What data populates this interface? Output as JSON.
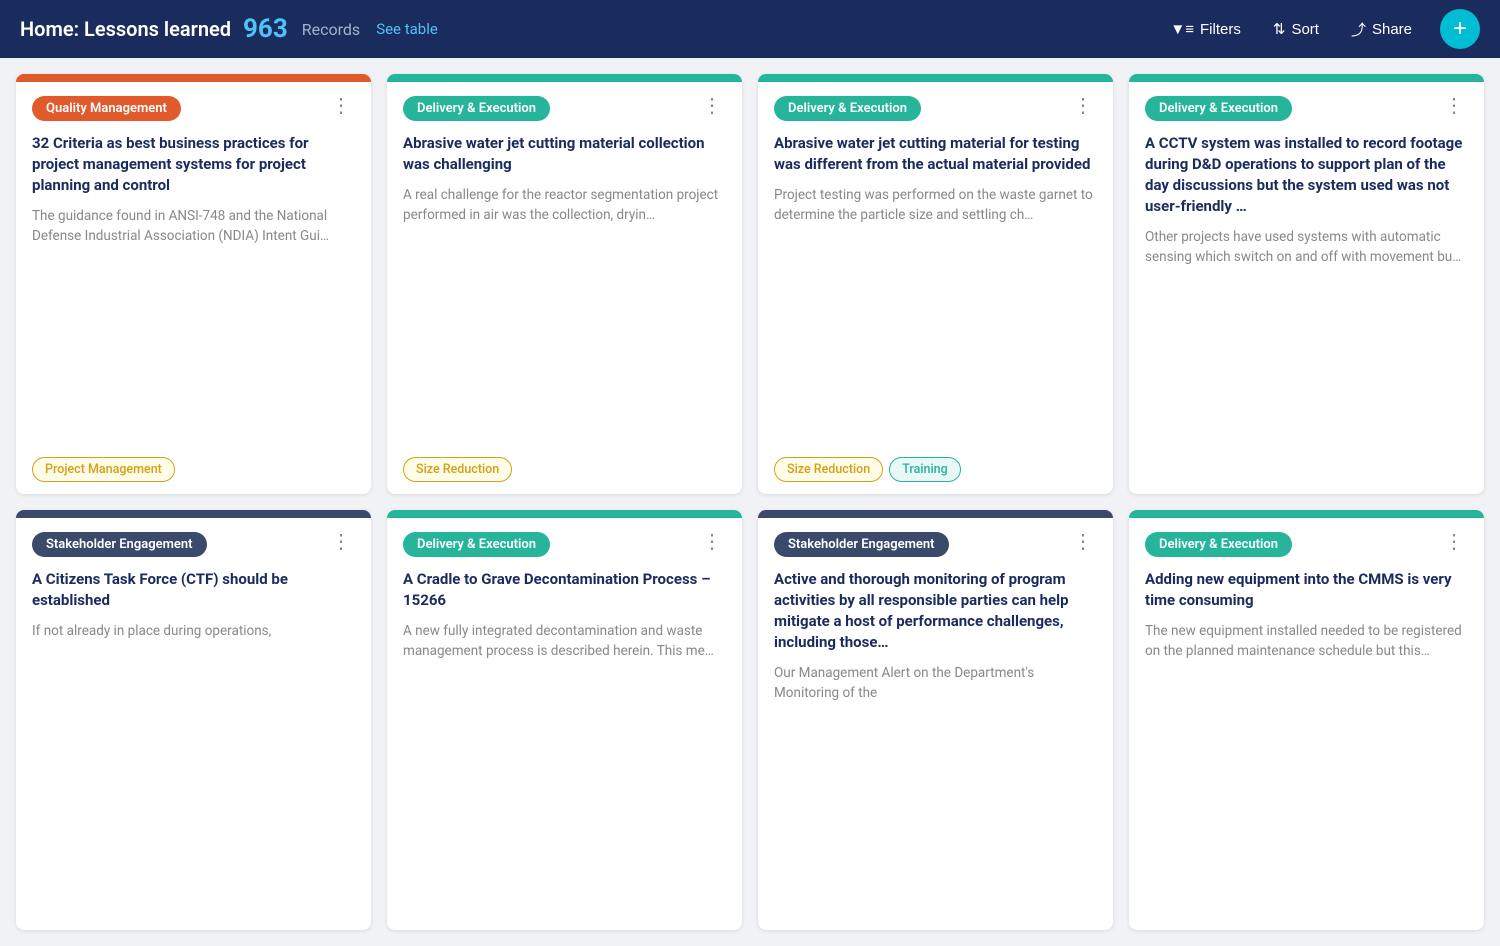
{
  "header": {
    "title": "Home: Lessons learned",
    "count": "963",
    "records_label": "Records",
    "see_table": "See table",
    "filters_label": "Filters",
    "sort_label": "Sort",
    "share_label": "Share",
    "add_label": "+"
  },
  "cards": [
    {
      "id": "card-1",
      "top_color": "#e05a2b",
      "badge_label": "Quality Management",
      "badge_class": "badge-red",
      "accent_class": "accent-blue",
      "title": "32 Criteria as best business practices for project management systems for project planning and control",
      "desc": "The guidance found in ANSI-748 and the National Defense Industrial Association (NDIA) Intent Gui…",
      "tags": [
        {
          "label": "Project Management",
          "class": "tag-yellow"
        }
      ]
    },
    {
      "id": "card-2",
      "top_color": "#26b59b",
      "badge_label": "Delivery & Execution",
      "badge_class": "badge-teal",
      "accent_class": "accent-teal",
      "title": "Abrasive water jet cutting material collection was challenging",
      "desc": "A real challenge for the reactor segmentation project performed in air was the collection, dryin…",
      "tags": [
        {
          "label": "Size Reduction",
          "class": "tag-yellow"
        }
      ]
    },
    {
      "id": "card-3",
      "top_color": "#26b59b",
      "badge_label": "Delivery & Execution",
      "badge_class": "badge-teal",
      "accent_class": "accent-teal",
      "title": "Abrasive water jet cutting material for testing was different from the actual material provided",
      "desc": "Project testing was performed on the waste garnet to determine the particle size and settling ch…",
      "tags": [
        {
          "label": "Size Reduction",
          "class": "tag-yellow"
        },
        {
          "label": "Training",
          "class": "tag-green"
        }
      ]
    },
    {
      "id": "card-4",
      "top_color": "#26b59b",
      "badge_label": "Delivery & Execution",
      "badge_class": "badge-teal",
      "accent_class": "accent-teal",
      "title": "A CCTV system was installed to record footage during D&D operations to support plan of the day discussions but the system used was not user-friendly …",
      "desc": "Other projects have used systems with automatic sensing which switch on and off with movement bu…",
      "tags": []
    },
    {
      "id": "card-5",
      "top_color": "#3a4a6b",
      "badge_label": "Stakeholder Engagement",
      "badge_class": "badge-dark",
      "accent_class": "accent-dark",
      "title": "A Citizens Task Force (CTF) should be established",
      "desc": "If not already in place during operations,",
      "tags": []
    },
    {
      "id": "card-6",
      "top_color": "#26b59b",
      "badge_label": "Delivery & Execution",
      "badge_class": "badge-teal",
      "accent_class": "accent-teal",
      "title": "A Cradle to Grave Decontamination Process – 15266",
      "desc": "A new fully integrated decontamination and waste management process is described herein. This me…",
      "tags": []
    },
    {
      "id": "card-7",
      "top_color": "#3a4a6b",
      "badge_label": "Stakeholder Engagement",
      "badge_class": "badge-dark",
      "accent_class": "accent-dark",
      "title": "Active and thorough monitoring of program activities by all responsible parties can help mitigate a host of performance challenges, including those…",
      "desc": "Our Management Alert on the Department's Monitoring of the",
      "tags": []
    },
    {
      "id": "card-8",
      "top_color": "#26b59b",
      "badge_label": "Delivery & Execution",
      "badge_class": "badge-teal",
      "accent_class": "accent-teal",
      "title": "Adding new equipment into the CMMS is very time consuming",
      "desc": "The new equipment installed needed to be registered on the planned maintenance schedule but this…",
      "tags": []
    }
  ]
}
